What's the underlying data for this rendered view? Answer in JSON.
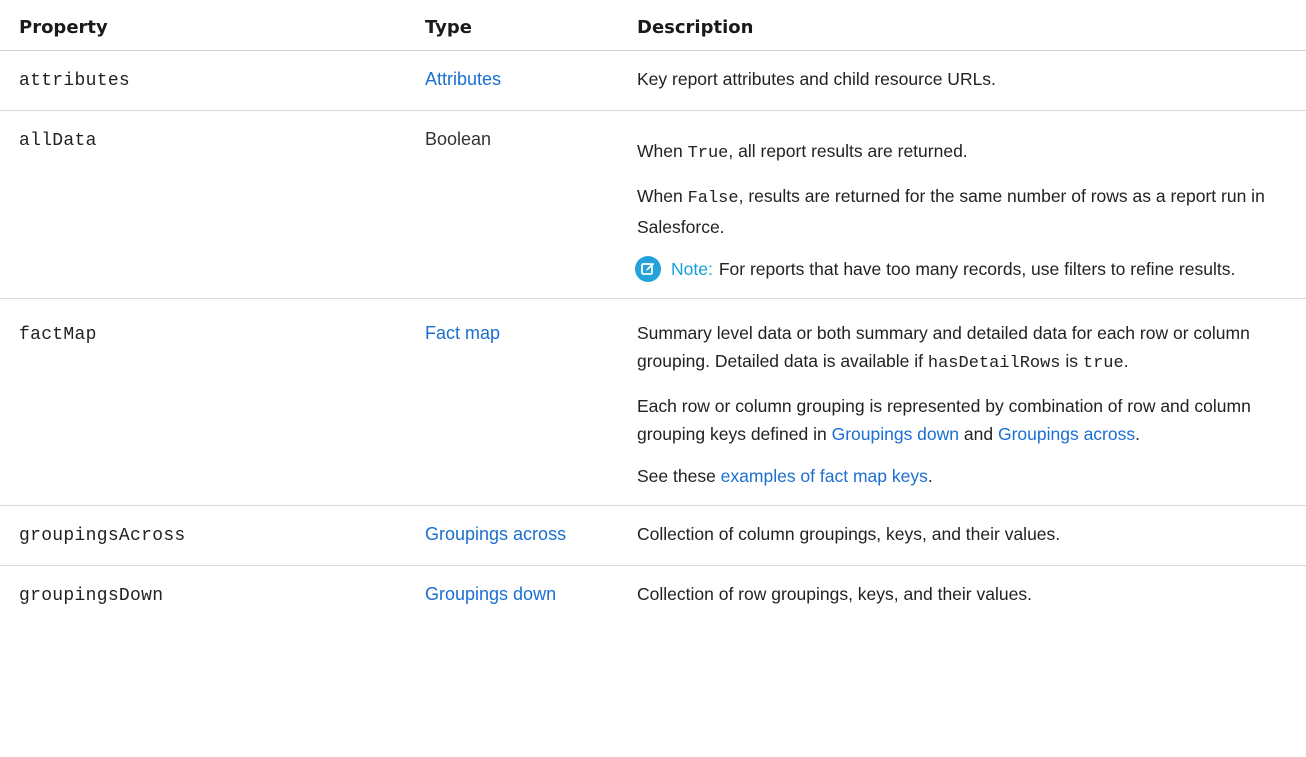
{
  "headers": {
    "property": "Property",
    "type": "Type",
    "description": "Description"
  },
  "rows": [
    {
      "property": "attributes",
      "type": "Attributes",
      "description": "Key report attributes and child resource URLs."
    },
    {
      "property": "allData",
      "type": "Boolean",
      "desc_p1_a": "When ",
      "desc_p1_code": "True",
      "desc_p1_b": ", all report results are returned.",
      "desc_p2_a": "When ",
      "desc_p2_code": "False",
      "desc_p2_b": ", results are returned for the same number of rows as a report run in Salesforce.",
      "note_label": "Note:",
      "note_text": "For reports that have too many records, use filters to refine results.",
      "note_icon": "edit-note-icon"
    },
    {
      "property": "factMap",
      "type": "Fact map",
      "desc_p1_a": "Summary level data or both summary and detailed data for each row or column grouping. Detailed data is available if ",
      "desc_p1_code1": "hasDetailRows",
      "desc_p1_b": " is ",
      "desc_p1_code2": "true",
      "desc_p1_c": ".",
      "desc_p2_a": "Each row or column grouping is represented by combination of row and column grouping keys defined in ",
      "desc_p2_link1": "Groupings down",
      "desc_p2_b": " and ",
      "desc_p2_link2": "Groupings across",
      "desc_p2_c": ".",
      "desc_p3_a": "See these ",
      "desc_p3_link": "examples of fact map keys",
      "desc_p3_b": "."
    },
    {
      "property": "groupingsAcross",
      "type": "Groupings across",
      "description": "Collection of column groupings, keys, and their values."
    },
    {
      "property": "groupingsDown",
      "type": "Groupings down",
      "description": "Collection of row groupings, keys, and their values."
    }
  ],
  "colors": {
    "link": "#1a6fd1",
    "note_accent": "#16a0d7"
  }
}
